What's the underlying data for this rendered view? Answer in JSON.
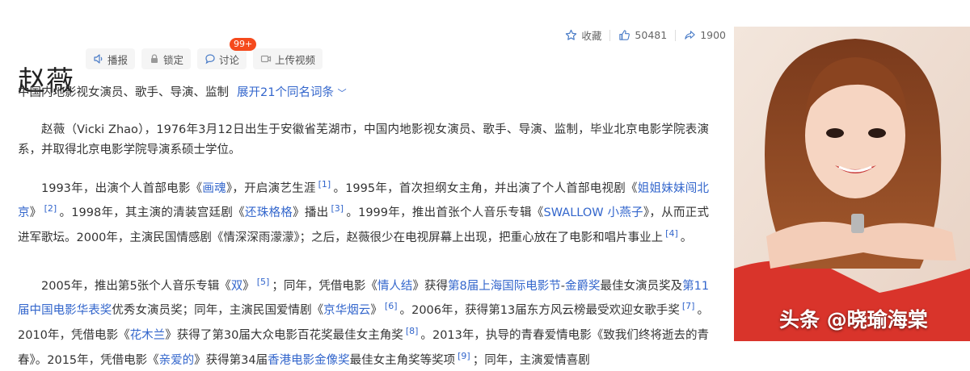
{
  "header": {
    "title": "赵薇",
    "tools": {
      "report": "播报",
      "lock": "锁定",
      "discuss": "讨论",
      "discuss_badge": "99+",
      "upload": "上传视频"
    },
    "stats": {
      "collect": "收藏",
      "likes": "50481",
      "shares": "1900"
    }
  },
  "subtitle": {
    "desc": "中国内地影视女演员、歌手、导演、监制",
    "expand": "展开21个同名词条"
  },
  "para1": {
    "t1": "赵薇（Vicki Zhao），1976年3月12日出生于安徽省芜湖市，中国内地影视女演员、歌手、导演、监制，毕业北京电影学院表演系，并取得北京电影学院导演系硕士学位。"
  },
  "para2": {
    "t1": "1993年，出演个人首部电影《",
    "l1": "画魂",
    "t2": "》，开启演艺生涯",
    "r1": "[1]",
    "t3": "。1995年，首次担纲女主角，并出演了个人首部电视剧《",
    "l2": "姐姐妹妹闯北京",
    "t4": "》",
    "r2": "[2]",
    "t5": "。1998年，其主演的清装宫廷剧《",
    "l3": "还珠格格",
    "t6": "》播出",
    "r3": "[3]",
    "t7": "。1999年，推出首张个人音乐专辑《",
    "l4": "SWALLOW 小燕子",
    "t8": "》，从而正式进军歌坛。2000年，主演民国情感剧《情深深雨濛濛》；之后，赵薇很少在电视屏幕上出现，把重心放在了电影和唱片事业上",
    "r4": "[4]",
    "t9": "。"
  },
  "para3": {
    "t1": "2005年，推出第5张个人音乐专辑《",
    "l1": "双",
    "t2": "》",
    "r5": "[5]",
    "t3": "；同年，凭借电影《",
    "l2": "情人结",
    "t4": "》获得",
    "l3": "第8届上海国际电影节",
    "t5": "-",
    "l4": "金爵奖",
    "t6": "最佳女演员奖及",
    "l5": "第11届中国电影华表奖",
    "t7": "优秀女演员奖；同年，主演民国爱情剧《",
    "l6": "京华烟云",
    "t8": "》",
    "r6": "[6]",
    "t9": "。2006年，获得第13届东方风云榜最受欢迎女歌手奖",
    "r7": "[7]",
    "t10": "。2010年，凭借电影《",
    "l7": "花木兰",
    "t11": "》获得了第30届大众电影百花奖最佳女主角奖",
    "r8": "[8]",
    "t12": "。2013年，执导的青春爱情电影《致我们终将逝去的青春》。2015年，凭借电影《",
    "l8": "亲爱的",
    "t13": "》获得第34届",
    "l9": "香港电影金像奖",
    "t14": "最佳女主角奖等奖项",
    "r9": "[9]",
    "t15": "；同年，主演爱情喜剧"
  },
  "photo": {
    "watermark": "头条 @晓瑜海棠"
  },
  "colors": {
    "link": "#3366cc",
    "badge": "#f54a1d",
    "tool_bg": "#f5f5f5"
  }
}
